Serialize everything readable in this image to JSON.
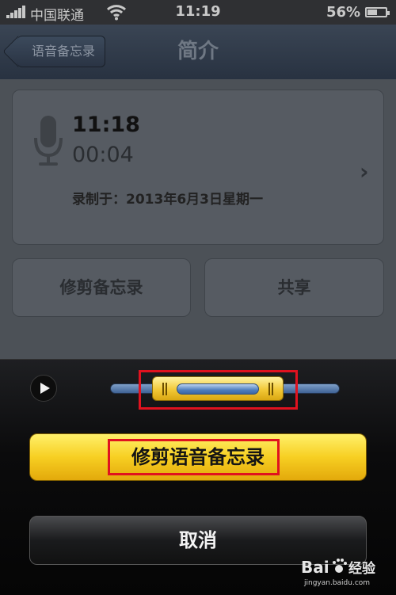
{
  "status_bar": {
    "carrier": "中国联通",
    "time": "11:19",
    "battery_percent_label": "56%",
    "battery_level": 0.56,
    "icons": [
      "signal-bars-icon",
      "wifi-icon",
      "battery-icon"
    ]
  },
  "nav": {
    "back_label": "语音备忘录",
    "title": "简介"
  },
  "memo": {
    "time": "11:18",
    "duration": "00:04",
    "recorded_label": "录制于：",
    "recorded_date": "2013年6月3日星期一",
    "icon": "microphone-icon"
  },
  "actions": {
    "trim_memo": "修剪备忘录",
    "share": "共享"
  },
  "trim_sheet": {
    "play_icon": "play-icon",
    "trim_button": "修剪语音备忘录",
    "cancel_button": "取消"
  },
  "watermark": {
    "logo_text": "Bai经验",
    "url": "jingyan.baidu.com"
  },
  "colors": {
    "annotation": "#e0121f",
    "trim_button": "#f7cf22",
    "nav_bar": "#2f3a49"
  }
}
